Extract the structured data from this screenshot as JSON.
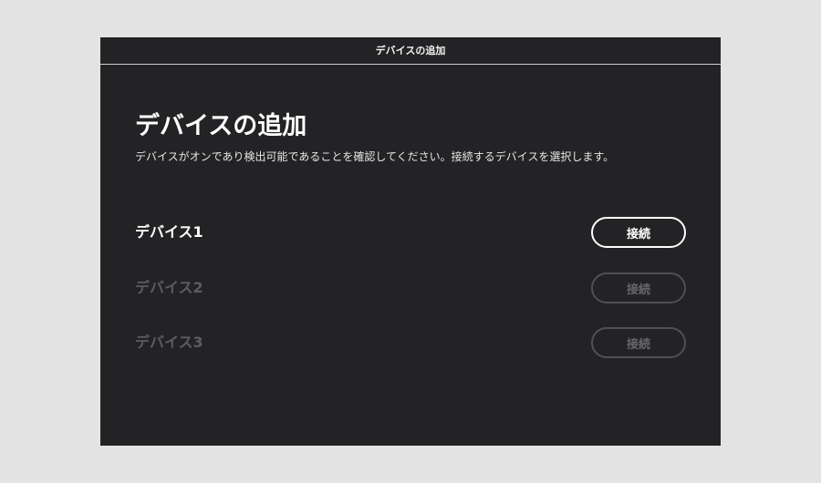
{
  "dialog": {
    "title": "デバイスの追加",
    "heading": "デバイスの追加",
    "description": "デバイスがオンであり検出可能であることを確認してください。接続するデバイスを選択します。"
  },
  "devices": [
    {
      "name": "デバイス1",
      "button_label": "接続",
      "enabled": true
    },
    {
      "name": "デバイス2",
      "button_label": "接続",
      "enabled": false
    },
    {
      "name": "デバイス3",
      "button_label": "接続",
      "enabled": false
    }
  ],
  "colors": {
    "page_background": "#e3e3e3",
    "window_background": "#232325",
    "text_primary": "#ffffff",
    "text_disabled": "#5c5c60",
    "button_border_disabled": "#505054"
  }
}
